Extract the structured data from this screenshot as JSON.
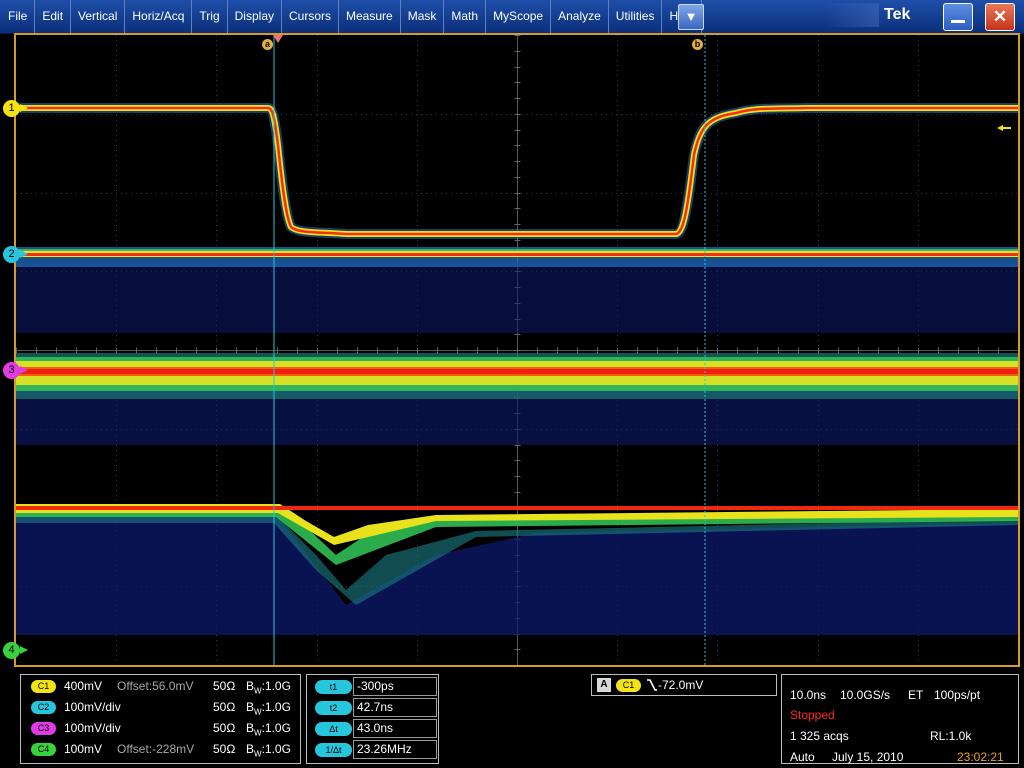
{
  "menu": {
    "items": [
      "File",
      "Edit",
      "Vertical",
      "Horiz/Acq",
      "Trig",
      "Display",
      "Cursors",
      "Measure",
      "Mask",
      "Math",
      "MyScope",
      "Analyze",
      "Utilities",
      "Help"
    ],
    "dropdown_glyph": "▼",
    "logo": "Tek",
    "minimize_icon": "minimize-icon",
    "close_glyph": "✕"
  },
  "display": {
    "cursor_a_label": "a",
    "cursor_b_label": "b",
    "channel_markers": [
      "1",
      "2",
      "3",
      "4"
    ]
  },
  "channels": [
    {
      "badge": "C1",
      "scale": "400mV",
      "offset": "Offset:56.0mV",
      "impedance": "50Ω",
      "bw": "B",
      "bw_sub": "W",
      "bw_val": ":1.0G",
      "color": "#f3e313"
    },
    {
      "badge": "C2",
      "scale": "100mV/div",
      "offset": "",
      "impedance": "50Ω",
      "bw": "B",
      "bw_sub": "W",
      "bw_val": ":1.0G",
      "color": "#26c7dc"
    },
    {
      "badge": "C3",
      "scale": "100mV/div",
      "offset": "",
      "impedance": "50Ω",
      "bw": "B",
      "bw_sub": "W",
      "bw_val": ":1.0G",
      "color": "#e03ce6"
    },
    {
      "badge": "C4",
      "scale": "100mV",
      "offset": "Offset:-228mV",
      "impedance": "50Ω",
      "bw": "B",
      "bw_sub": "W",
      "bw_val": ":1.0G",
      "color": "#38d23e"
    }
  ],
  "cursors": [
    {
      "label": "t1",
      "value": "-300ps"
    },
    {
      "label": "t2",
      "value": "42.7ns"
    },
    {
      "label": "Δt",
      "value": "43.0ns"
    },
    {
      "label": "1/Δt",
      "value": "23.26MHz"
    }
  ],
  "trigger": {
    "source_letter": "A",
    "channel": "C1",
    "value": "-72.0mV"
  },
  "acquisition": {
    "timebase": "10.0ns",
    "sample_rate": "10.0GS/s",
    "mode": "ET",
    "resolution": "100ps/pt",
    "state": "Stopped",
    "acqs": "1 325 acqs",
    "record_length": "RL:1.0k",
    "trigger_mode": "Auto",
    "date": "July 15, 2010",
    "time": "23:02:21"
  },
  "colors": {
    "menubar": "#0b2f7a",
    "graticule_border": "#d69a28",
    "ch1": "#f3e313",
    "ch2": "#26c7dc",
    "ch3": "#e03ce6",
    "ch4": "#38d23e",
    "cursor_line": "#26c7dc",
    "stopped": "#ff2a1e",
    "time": "#f0a020"
  }
}
